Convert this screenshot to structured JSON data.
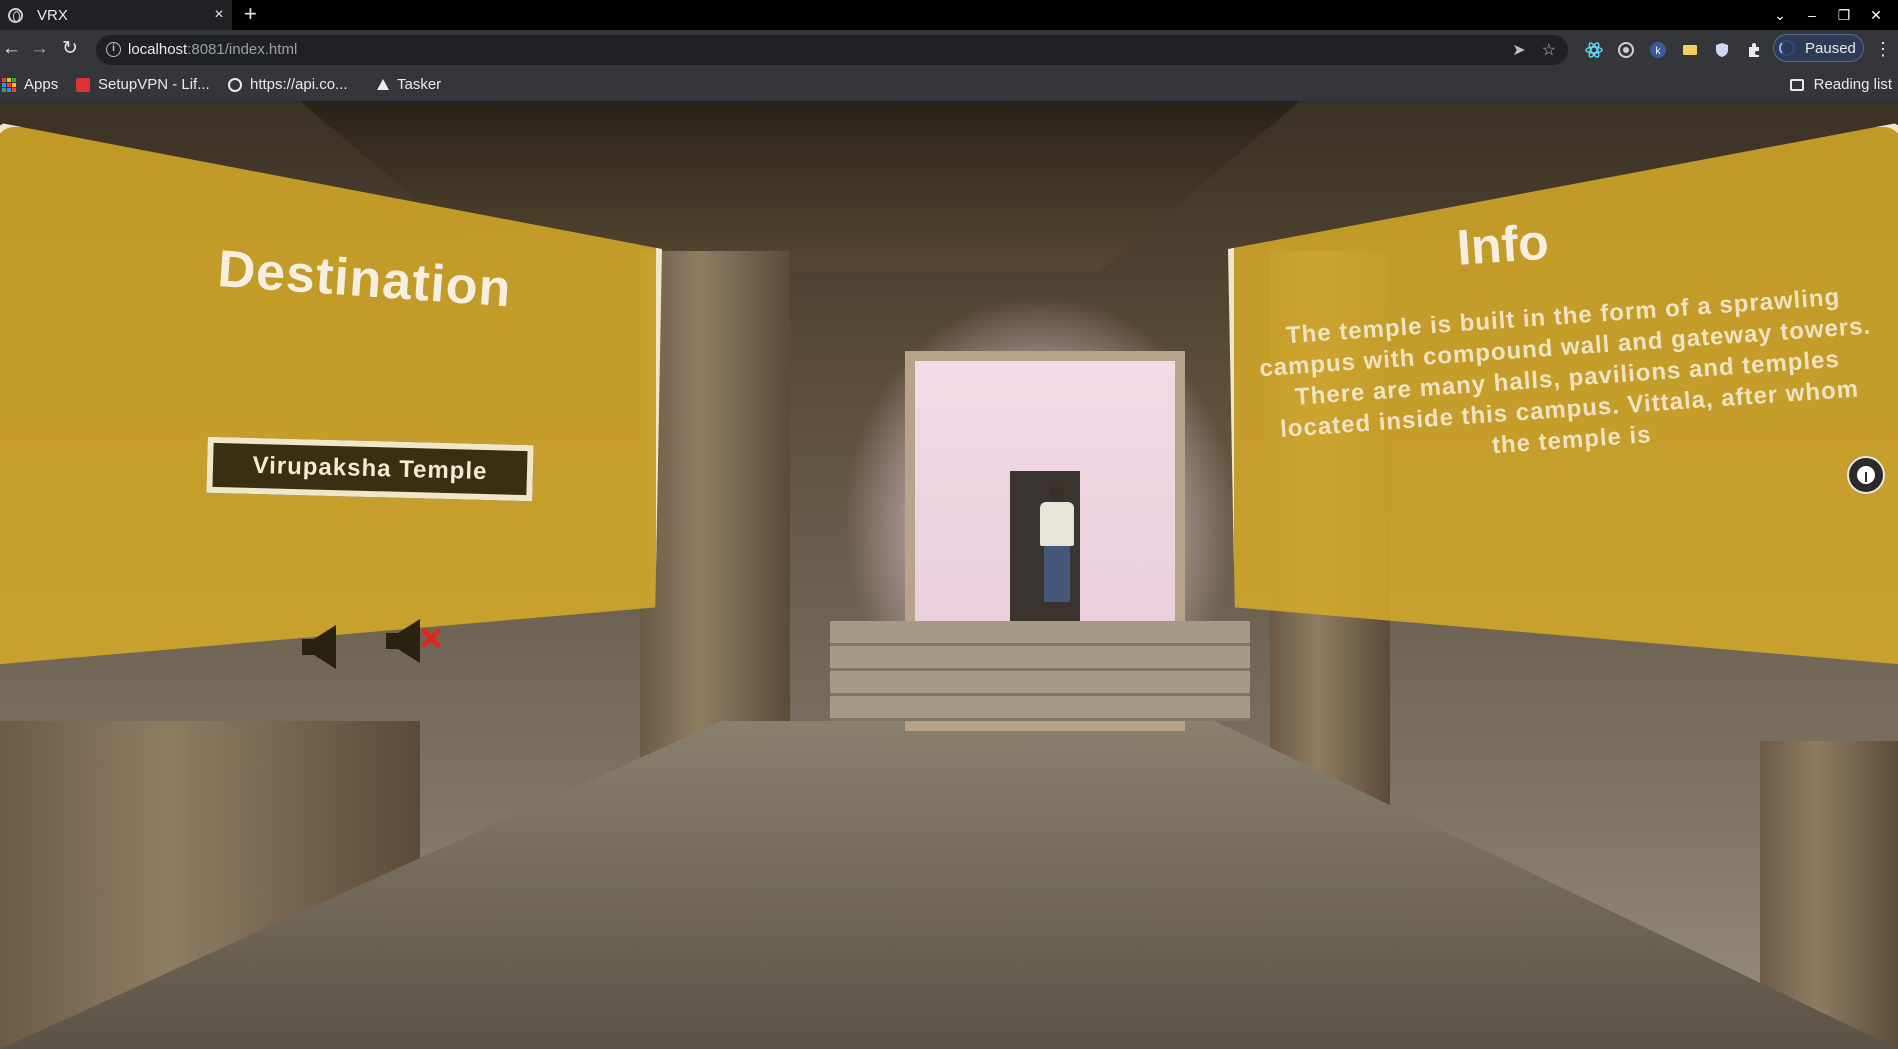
{
  "browser": {
    "tab_title": "VRX",
    "tab_close": "×",
    "new_tab": "+",
    "url_host": "localhost",
    "url_rest": ":8081/index.html",
    "profile_status": "Paused",
    "bookmarks": [
      {
        "label": "Apps",
        "icon": "apps-grid-icon"
      },
      {
        "label": "SetupVPN - Lif...",
        "icon": "vpn-icon"
      },
      {
        "label": "https://api.co...",
        "icon": "globe-icon"
      },
      {
        "label": "Tasker",
        "icon": "tasker-icon"
      }
    ],
    "reading_list": "Reading list"
  },
  "vr": {
    "destination_title": "Destination",
    "destination_value": "Virupaksha Temple",
    "sound_on_icon": "speaker-icon",
    "sound_off_icon": "speaker-muted-icon",
    "info_title": "Info",
    "info_text": "The temple is built in the form of a sprawling campus with compound wall and gateway towers. There are many halls, pavilions and temples located inside this campus. Vittala, after whom the temple is",
    "controller_icon": "vr-controller-icon"
  },
  "colors": {
    "panel": "#d6aa28",
    "panel_border": "#efe6cc",
    "field_bg": "#3a2f10"
  }
}
